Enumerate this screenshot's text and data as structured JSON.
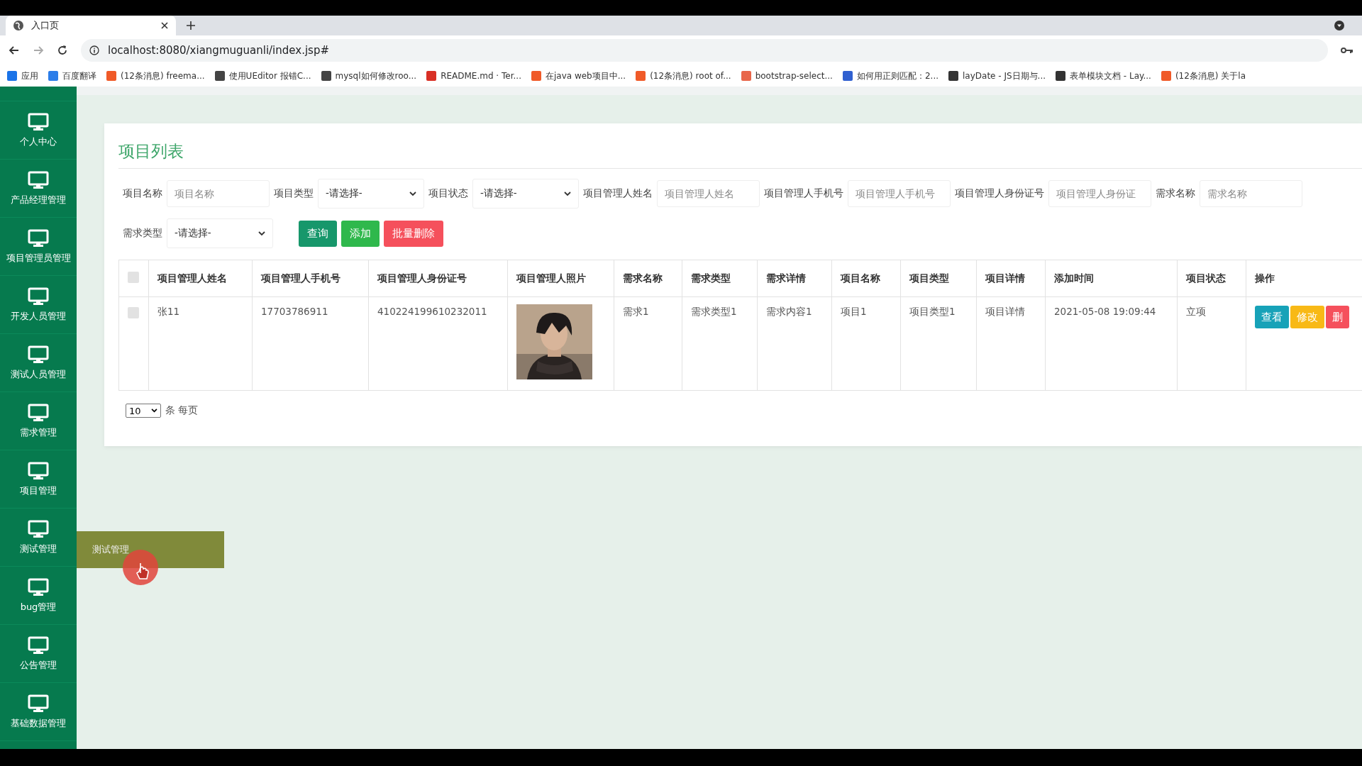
{
  "browser": {
    "tab_title": "入口页",
    "url": "localhost:8080/xiangmuguanli/index.jsp#",
    "bookmarks": [
      {
        "label": "应用",
        "color": "#1a73e8"
      },
      {
        "label": "百度翻译",
        "color": "#2b7de9"
      },
      {
        "label": "(12条消息) freema...",
        "color": "#f05a28"
      },
      {
        "label": "使用UEditor 报错C...",
        "color": "#444444"
      },
      {
        "label": "mysql如何修改roo...",
        "color": "#444444"
      },
      {
        "label": "README.md · Ter...",
        "color": "#d93025"
      },
      {
        "label": "在java web项目中...",
        "color": "#f05a28"
      },
      {
        "label": "(12条消息) root of...",
        "color": "#f05a28"
      },
      {
        "label": "bootstrap-select...",
        "color": "#e8664a"
      },
      {
        "label": "如何用正则匹配：2...",
        "color": "#3060d0"
      },
      {
        "label": "layDate - JS日期与...",
        "color": "#333333"
      },
      {
        "label": "表单模块文档 - Lay...",
        "color": "#333333"
      },
      {
        "label": "(12条消息) 关于la",
        "color": "#f05a28"
      }
    ]
  },
  "sidebar": {
    "items": [
      {
        "label": "个人中心"
      },
      {
        "label": "产品经理管理"
      },
      {
        "label": "项目管理员管理"
      },
      {
        "label": "开发人员管理"
      },
      {
        "label": "测试人员管理"
      },
      {
        "label": "需求管理"
      },
      {
        "label": "项目管理"
      },
      {
        "label": "测试管理"
      },
      {
        "label": "bug管理"
      },
      {
        "label": "公告管理"
      },
      {
        "label": "基础数据管理"
      }
    ]
  },
  "tooltip": {
    "text": "测试管理"
  },
  "title": "项目列表",
  "filters": [
    {
      "label": "项目名称",
      "kind": "input",
      "placeholder": "项目名称"
    },
    {
      "label": "项目类型",
      "kind": "select",
      "value": "-请选择-"
    },
    {
      "label": "项目状态",
      "kind": "select",
      "value": "-请选择-"
    },
    {
      "label": "项目管理人姓名",
      "kind": "input",
      "placeholder": "项目管理人姓名"
    },
    {
      "label": "项目管理人手机号",
      "kind": "input",
      "placeholder": "项目管理人手机号"
    },
    {
      "label": "项目管理人身份证号",
      "kind": "input",
      "placeholder": "项目管理人身份证"
    },
    {
      "label": "需求名称",
      "kind": "input",
      "placeholder": "需求名称"
    },
    {
      "label": "需求类型",
      "kind": "select",
      "value": "-请选择-"
    }
  ],
  "actions": [
    {
      "label": "查询",
      "kind": "search"
    },
    {
      "label": "添加",
      "kind": "add"
    },
    {
      "label": "批量删除",
      "kind": "delete"
    }
  ],
  "table": {
    "all_checked": false,
    "columns": [
      "项目管理人姓名",
      "项目管理人手机号",
      "项目管理人身份证号",
      "项目管理人照片",
      "需求名称",
      "需求类型",
      "需求详情",
      "项目名称",
      "项目类型",
      "项目详情",
      "添加时间",
      "项目状态",
      "操作"
    ],
    "rows": [
      {
        "checked": false,
        "cells": [
          "张11",
          "17703786911",
          "410224199610232011",
          {
            "kind": "picture"
          },
          "需求1",
          "需求类型1",
          "需求内容1",
          "项目1",
          "项目类型1",
          "项目详情",
          "2021-05-08 19:09:44",
          "立项"
        ],
        "buttons": [
          {
            "label": "查看",
            "kind": "view"
          },
          {
            "label": "修改",
            "kind": "edit"
          },
          {
            "label": "删",
            "kind": "delete"
          }
        ]
      }
    ]
  },
  "pager": {
    "page_size": "10",
    "suffix": "条 每页"
  }
}
